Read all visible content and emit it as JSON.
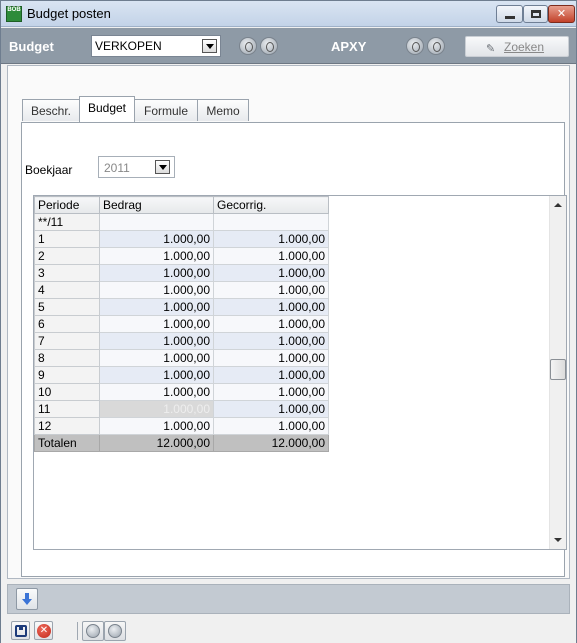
{
  "window": {
    "title": "Budget posten",
    "app_icon_text": "BOB"
  },
  "header": {
    "budget_label": "Budget",
    "budget_value": "VERKOPEN",
    "company_label": "APXY",
    "search_label": "Zoeken"
  },
  "tabs": [
    {
      "label": "Beschr.",
      "active": false
    },
    {
      "label": "Budget",
      "active": true
    },
    {
      "label": "Formule",
      "active": false
    },
    {
      "label": "Memo",
      "active": false
    }
  ],
  "boekjaar": {
    "label": "Boekjaar",
    "value": "2011"
  },
  "grid": {
    "columns": [
      "Periode",
      "Bedrag",
      "Gecorrig."
    ],
    "rows": [
      {
        "periode": "**/11",
        "bedrag": "",
        "gecorrig": ""
      },
      {
        "periode": "1",
        "bedrag": "1.000,00",
        "gecorrig": "1.000,00"
      },
      {
        "periode": "2",
        "bedrag": "1.000,00",
        "gecorrig": "1.000,00"
      },
      {
        "periode": "3",
        "bedrag": "1.000,00",
        "gecorrig": "1.000,00"
      },
      {
        "periode": "4",
        "bedrag": "1.000,00",
        "gecorrig": "1.000,00"
      },
      {
        "periode": "5",
        "bedrag": "1.000,00",
        "gecorrig": "1.000,00"
      },
      {
        "periode": "6",
        "bedrag": "1.000,00",
        "gecorrig": "1.000,00"
      },
      {
        "periode": "7",
        "bedrag": "1.000,00",
        "gecorrig": "1.000,00"
      },
      {
        "periode": "8",
        "bedrag": "1.000,00",
        "gecorrig": "1.000,00"
      },
      {
        "periode": "9",
        "bedrag": "1.000,00",
        "gecorrig": "1.000,00"
      },
      {
        "periode": "10",
        "bedrag": "1.000,00",
        "gecorrig": "1.000,00"
      },
      {
        "periode": "11",
        "bedrag": "1.000,00",
        "gecorrig": "1.000,00"
      },
      {
        "periode": "12",
        "bedrag": "1.000,00",
        "gecorrig": "1.000,00"
      }
    ],
    "totals": {
      "label": "Totalen",
      "bedrag": "12.000,00",
      "gecorrig": "12.000,00"
    }
  },
  "icons": {
    "app": "app-logo-icon",
    "minimize": "minimize-icon",
    "maximize": "maximize-icon",
    "close": "close-icon",
    "dropdown": "chevron-down-icon",
    "previous": "previous-record-icon",
    "next": "next-record-icon",
    "search": "search-icon",
    "move_down": "arrow-down-icon",
    "save": "save-icon",
    "cancel": "cancel-icon"
  },
  "colors": {
    "header_bg": "#8e9aa6",
    "stripe": "#e6ebf5",
    "totals_bg": "#c0c0c0",
    "accent_arrow": "#3b74d6"
  }
}
